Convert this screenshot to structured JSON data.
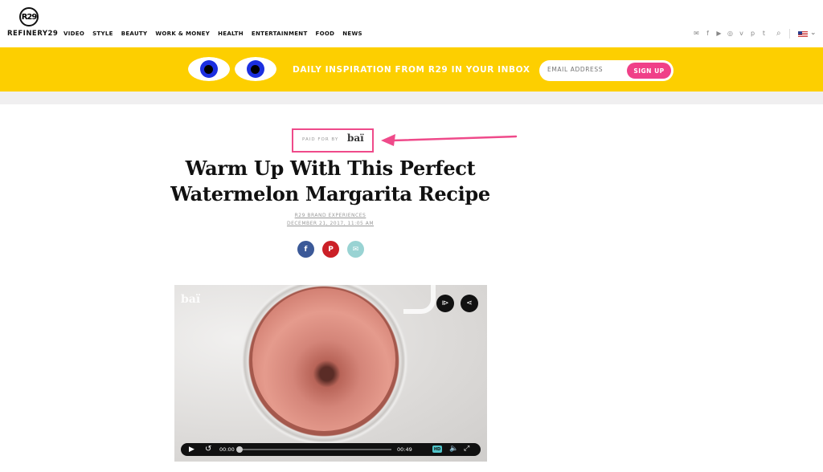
{
  "header": {
    "logo_mark": "R29",
    "logo_text": "REFINERY29",
    "nav": [
      "VIDEO",
      "STYLE",
      "BEAUTY",
      "WORK & MONEY",
      "HEALTH",
      "ENTERTAINMENT",
      "FOOD",
      "NEWS"
    ],
    "social_icons": [
      "mail-icon",
      "facebook-icon",
      "youtube-icon",
      "instagram-icon",
      "vine-icon",
      "pinterest-icon",
      "tumblr-icon"
    ],
    "search_icon": "search-icon",
    "region_flag": "us-flag-icon"
  },
  "banner": {
    "text": "DAILY INSPIRATION FROM R29 IN YOUR INBOX",
    "email_placeholder": "EMAIL ADDRESS",
    "signup_label": "SIGN UP",
    "bg_color": "#fdcf00",
    "button_color": "#f04088"
  },
  "article": {
    "paid_for_by": "PAID FOR BY",
    "sponsor": "baï",
    "title_line1": "Warm Up With This Perfect",
    "title_line2": "Watermelon Margarita Recipe",
    "author": "R29 BRAND EXPERIENCES",
    "date": "DECEMBER 21, 2017, 11:05 AM",
    "share": [
      "facebook-icon",
      "pinterest-icon",
      "email-icon"
    ]
  },
  "video": {
    "watermark": "baï",
    "current_time": "00:00",
    "duration": "00:49",
    "hd_label": "HD",
    "progress": 0
  }
}
